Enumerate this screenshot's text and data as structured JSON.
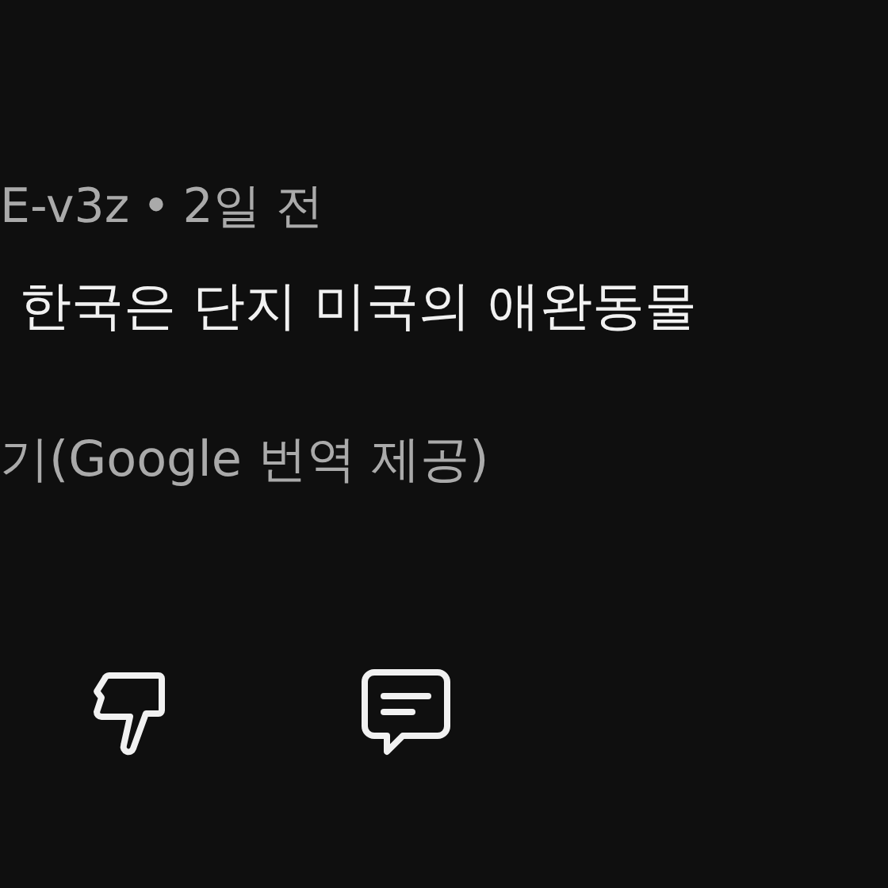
{
  "comment": {
    "author": "E-v3z",
    "separator": "•",
    "time": "2일 전",
    "text": "한국은 단지 미국의 애완동물",
    "translation_note": "기(Google 번역 제공)"
  },
  "actions": [
    {
      "kind": "dislike"
    },
    {
      "kind": "reply"
    }
  ]
}
